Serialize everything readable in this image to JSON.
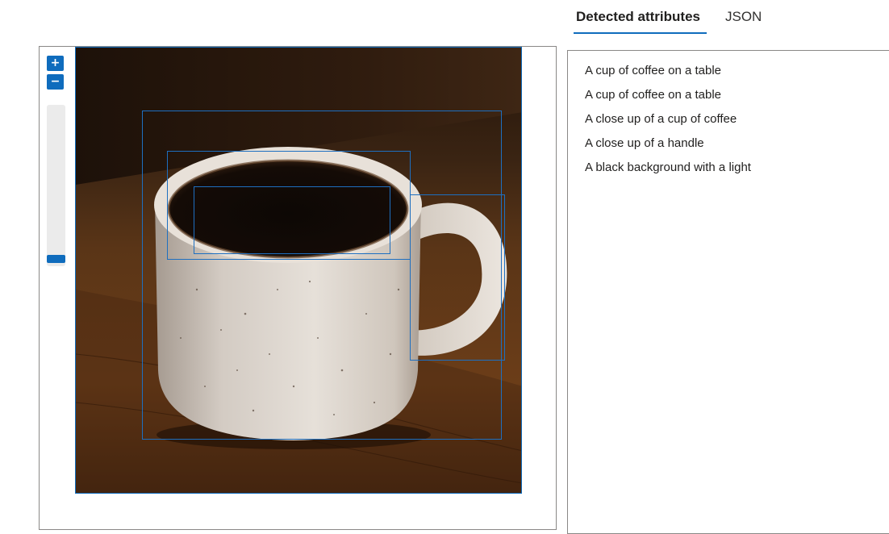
{
  "tabs": [
    {
      "label": "Detected attributes",
      "active": true
    },
    {
      "label": "JSON",
      "active": false
    }
  ],
  "zoom": {
    "zoom_in_label": "+",
    "zoom_out_label": "−",
    "level": 0.0
  },
  "image": {
    "icon": "coffee-mug-photo",
    "box_color": "#1e6fc0"
  },
  "attributes": [
    "A cup of coffee on a table",
    "A cup of coffee on a table",
    "A close up of a cup of coffee",
    "A close up of a handle",
    "A black background with a light"
  ],
  "colors": {
    "accent": "#0f6cbd",
    "border": "#8a8886"
  }
}
